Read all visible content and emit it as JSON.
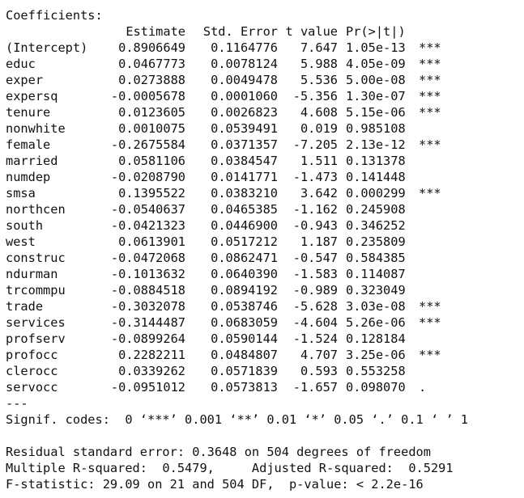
{
  "heading": "Coefficients:",
  "columns": {
    "estimate": "Estimate",
    "std_error": "Std. Error",
    "t_value": "t value",
    "p_value": "Pr(>|t|)"
  },
  "rows": [
    {
      "name": "(Intercept)",
      "estimate": "0.8906649",
      "std_error": "0.1164776",
      "t_value": "7.647",
      "p_value": "1.05e-13",
      "signif": "***"
    },
    {
      "name": "educ",
      "estimate": "0.0467773",
      "std_error": "0.0078124",
      "t_value": "5.988",
      "p_value": "4.05e-09",
      "signif": "***"
    },
    {
      "name": "exper",
      "estimate": "0.0273888",
      "std_error": "0.0049478",
      "t_value": "5.536",
      "p_value": "5.00e-08",
      "signif": "***"
    },
    {
      "name": "expersq",
      "estimate": "-0.0005678",
      "std_error": "0.0001060",
      "t_value": "-5.356",
      "p_value": "1.30e-07",
      "signif": "***"
    },
    {
      "name": "tenure",
      "estimate": "0.0123605",
      "std_error": "0.0026823",
      "t_value": "4.608",
      "p_value": "5.15e-06",
      "signif": "***"
    },
    {
      "name": "nonwhite",
      "estimate": "0.0010075",
      "std_error": "0.0539491",
      "t_value": "0.019",
      "p_value": "0.985108",
      "signif": ""
    },
    {
      "name": "female",
      "estimate": "-0.2675584",
      "std_error": "0.0371357",
      "t_value": "-7.205",
      "p_value": "2.13e-12",
      "signif": "***"
    },
    {
      "name": "married",
      "estimate": "0.0581106",
      "std_error": "0.0384547",
      "t_value": "1.511",
      "p_value": "0.131378",
      "signif": ""
    },
    {
      "name": "numdep",
      "estimate": "-0.0208790",
      "std_error": "0.0141771",
      "t_value": "-1.473",
      "p_value": "0.141448",
      "signif": ""
    },
    {
      "name": "smsa",
      "estimate": "0.1395522",
      "std_error": "0.0383210",
      "t_value": "3.642",
      "p_value": "0.000299",
      "signif": "***"
    },
    {
      "name": "northcen",
      "estimate": "-0.0540637",
      "std_error": "0.0465385",
      "t_value": "-1.162",
      "p_value": "0.245908",
      "signif": ""
    },
    {
      "name": "south",
      "estimate": "-0.0421323",
      "std_error": "0.0446900",
      "t_value": "-0.943",
      "p_value": "0.346252",
      "signif": ""
    },
    {
      "name": "west",
      "estimate": "0.0613901",
      "std_error": "0.0517212",
      "t_value": "1.187",
      "p_value": "0.235809",
      "signif": ""
    },
    {
      "name": "construc",
      "estimate": "-0.0472068",
      "std_error": "0.0862471",
      "t_value": "-0.547",
      "p_value": "0.584385",
      "signif": ""
    },
    {
      "name": "ndurman",
      "estimate": "-0.1013632",
      "std_error": "0.0640390",
      "t_value": "-1.583",
      "p_value": "0.114087",
      "signif": ""
    },
    {
      "name": "trcommpu",
      "estimate": "-0.0884518",
      "std_error": "0.0894192",
      "t_value": "-0.989",
      "p_value": "0.323049",
      "signif": ""
    },
    {
      "name": "trade",
      "estimate": "-0.3032078",
      "std_error": "0.0538746",
      "t_value": "-5.628",
      "p_value": "3.03e-08",
      "signif": "***"
    },
    {
      "name": "services",
      "estimate": "-0.3144487",
      "std_error": "0.0683059",
      "t_value": "-4.604",
      "p_value": "5.26e-06",
      "signif": "***"
    },
    {
      "name": "profserv",
      "estimate": "-0.0899264",
      "std_error": "0.0590144",
      "t_value": "-1.524",
      "p_value": "0.128184",
      "signif": ""
    },
    {
      "name": "profocc",
      "estimate": "0.2282211",
      "std_error": "0.0484807",
      "t_value": "4.707",
      "p_value": "3.25e-06",
      "signif": "***"
    },
    {
      "name": "clerocc",
      "estimate": "0.0339262",
      "std_error": "0.0571839",
      "t_value": "0.593",
      "p_value": "0.553258",
      "signif": ""
    },
    {
      "name": "servocc",
      "estimate": "-0.0951012",
      "std_error": "0.0573813",
      "t_value": "-1.657",
      "p_value": "0.098070",
      "signif": "."
    }
  ],
  "separator": "---",
  "signif_codes": "Signif. codes:  0 ‘***’ 0.001 ‘**’ 0.01 ‘*’ 0.05 ‘.’ 0.1 ‘ ’ 1",
  "residual_se": "Residual standard error: 0.3648 on 504 degrees of freedom",
  "r_squared": "Multiple R-squared:  0.5479,\tAdjusted R-squared:  0.5291",
  "f_statistic": "F-statistic: 29.09 on 21 and 504 DF,  p-value: < 2.2e-16"
}
